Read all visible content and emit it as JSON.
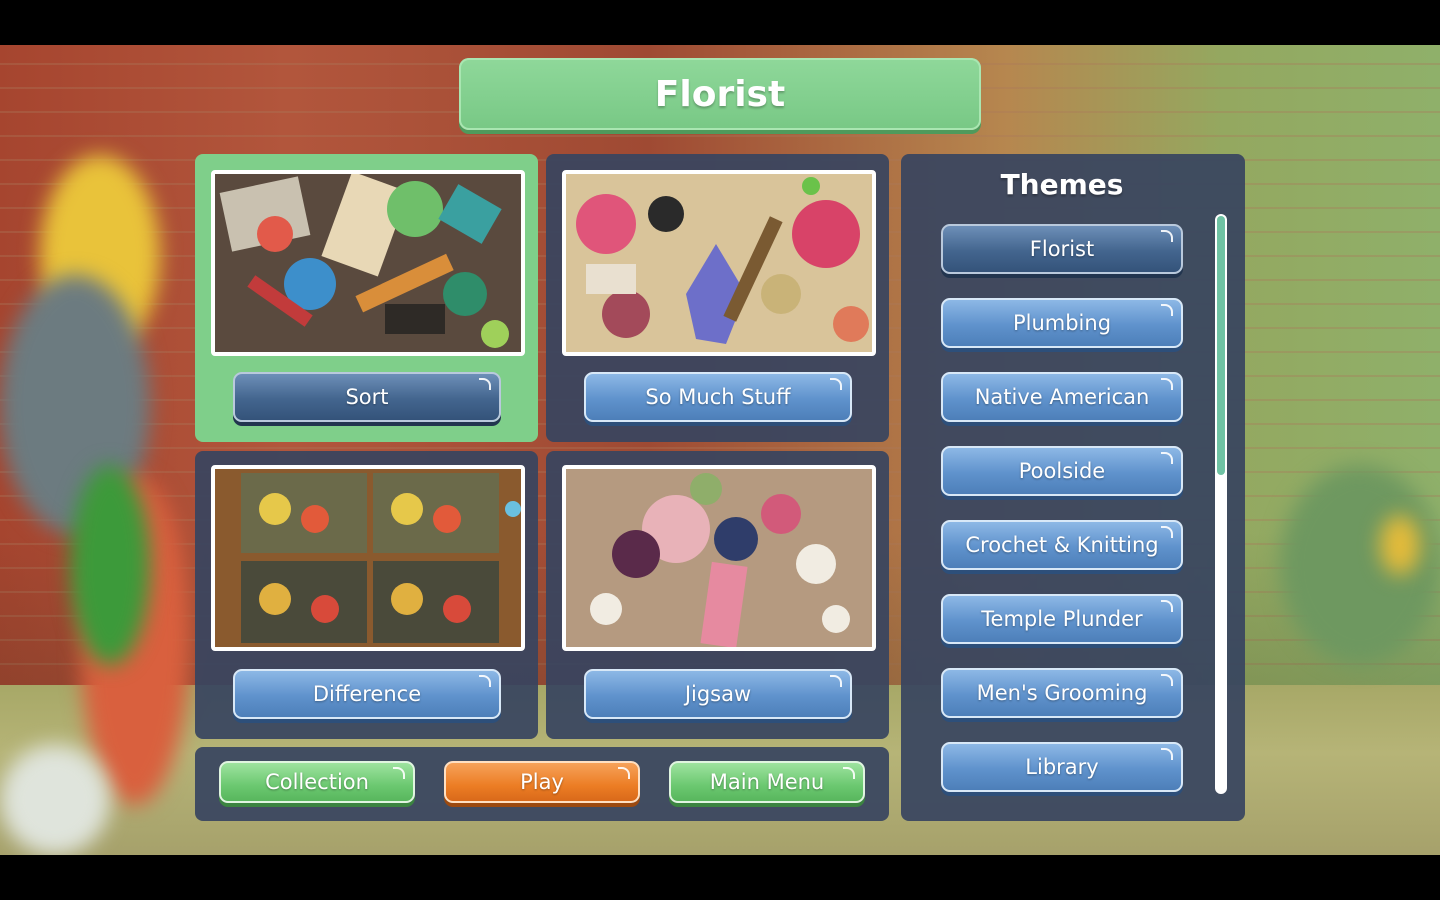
{
  "header": {
    "title": "Florist"
  },
  "games": [
    {
      "label": "Sort",
      "selected": true
    },
    {
      "label": "So Much Stuff",
      "selected": false
    },
    {
      "label": "Difference",
      "selected": false
    },
    {
      "label": "Jigsaw",
      "selected": false
    }
  ],
  "bottom_bar": {
    "collection_label": "Collection",
    "play_label": "Play",
    "main_menu_label": "Main Menu"
  },
  "themes": {
    "title": "Themes",
    "items": [
      {
        "label": "Florist",
        "selected": true
      },
      {
        "label": "Plumbing",
        "selected": false
      },
      {
        "label": "Native American",
        "selected": false
      },
      {
        "label": "Poolside",
        "selected": false
      },
      {
        "label": "Crochet & Knitting",
        "selected": false
      },
      {
        "label": "Temple Plunder",
        "selected": false
      },
      {
        "label": "Men's Grooming",
        "selected": false
      },
      {
        "label": "Library",
        "selected": false
      }
    ],
    "scroll_fraction_visible": 0.45
  },
  "colors": {
    "accent_green": "#7fcf8a",
    "button_blue": "#5f92cc",
    "button_orange": "#ec7d24",
    "panel_bg": "#37445f"
  }
}
